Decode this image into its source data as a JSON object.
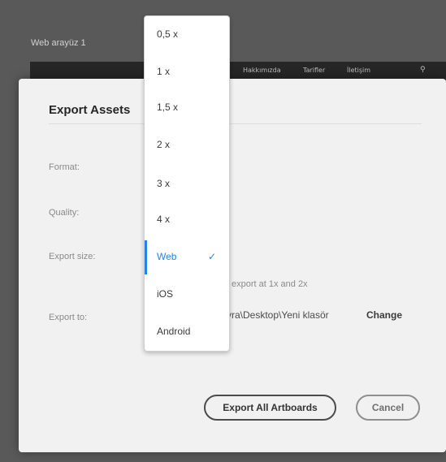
{
  "background": {
    "artboard_title": "Web arayüz 1",
    "nav_items": [
      "Hakkımızda",
      "Tarifler",
      "İletişim"
    ],
    "search_glyph": "⚲"
  },
  "dialog": {
    "title": "Export Assets",
    "labels": {
      "format": "Format:",
      "quality": "Quality:",
      "export_size": "Export size:",
      "export_to": "Export to:"
    },
    "export_size_hint": "export at 1x and 2x",
    "export_path": "yra\\Desktop\\Yeni klasör",
    "change_label": "Change",
    "export_button": "Export All Artboards",
    "cancel_button": "Cancel"
  },
  "dropdown": {
    "options": [
      "0,5 x",
      "1 x",
      "1,5 x",
      "2 x",
      "3 x",
      "4 x",
      "Web",
      "iOS",
      "Android"
    ],
    "selected": "Web",
    "check_glyph": "✓"
  },
  "colors": {
    "accent": "#2680eb",
    "dialog_bg": "#f1f1f1",
    "backdrop": "#595959"
  }
}
